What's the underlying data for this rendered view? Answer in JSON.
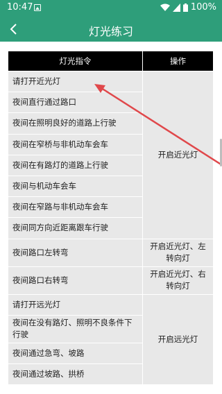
{
  "status": {
    "time": "10:47",
    "battery": "100%"
  },
  "header": {
    "title": "灯光练习"
  },
  "table": {
    "headers": [
      "灯光指令",
      "操作"
    ],
    "rows": [
      {
        "cmd": "请打开近光灯"
      },
      {
        "cmd": "夜间直行通过路口"
      },
      {
        "cmd": "夜间在照明良好的道路上行驶"
      },
      {
        "cmd": "夜间在窄桥与非机动车会车"
      },
      {
        "cmd": "夜间在有路灯的道路上行驶"
      },
      {
        "cmd": "夜间与机动车会车"
      },
      {
        "cmd": "夜间在窄路与非机动车会车"
      },
      {
        "cmd": "夜间同方向近距离跟车行驶"
      },
      {
        "cmd": "夜间路口左转弯"
      },
      {
        "cmd": "夜间路口右转弯"
      },
      {
        "cmd": "请打开远光灯"
      },
      {
        "cmd": "夜间在没有路灯、照明不良条件下行驶"
      },
      {
        "cmd": "夜间通过急弯、坡路"
      },
      {
        "cmd": "夜间通过坡路、拱桥"
      }
    ],
    "ops": {
      "near": "开启近光灯",
      "left": "开启近光灯、左转向灯",
      "right": "开启近光灯、右转向灯",
      "far": "开启远光灯"
    }
  },
  "colors": {
    "accent": "#2e9e7a",
    "header_bg": "#000000",
    "cell_bg": "#e8e8e8",
    "arrow": "#e0484b"
  }
}
